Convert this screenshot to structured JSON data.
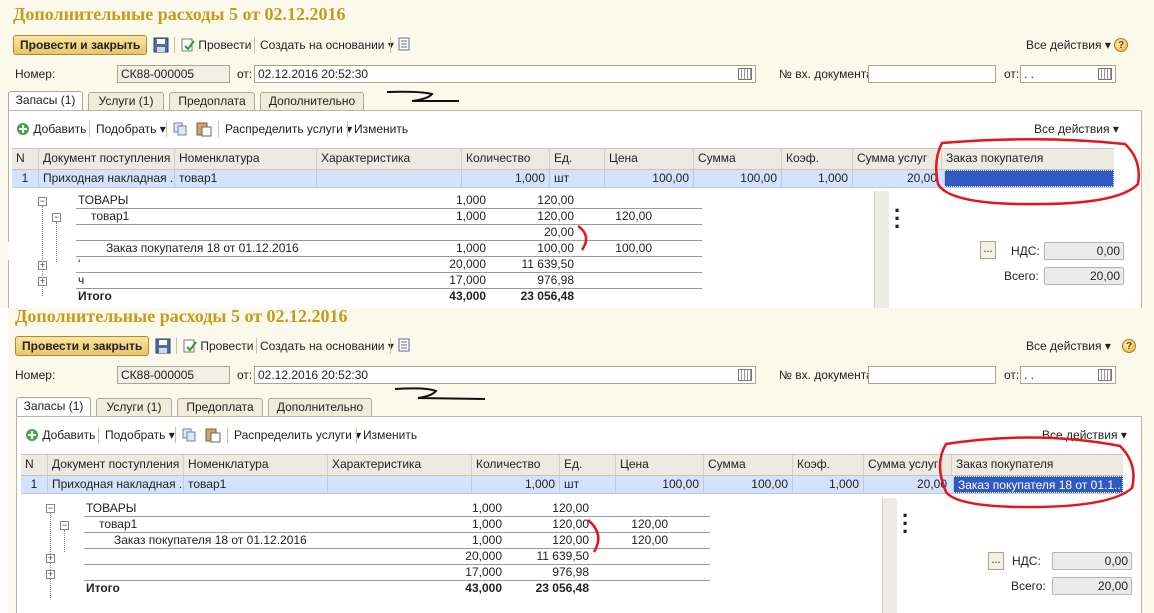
{
  "screens": [
    {
      "title": "Дополнительные расходы 5 от 02.12.2016",
      "toolbar": {
        "post_close": "Провести и закрыть",
        "post": "Провести",
        "create_based": "Создать на основании",
        "all_actions": "Все действия"
      },
      "form": {
        "number_label": "Номер:",
        "number": "СК88-000005",
        "date_label": "от:",
        "date": "02.12.2016 20:52:30",
        "in_doc_label": "№ вх. документа:",
        "in_doc": "",
        "in_date_label": "от:",
        "in_date": " .  ."
      },
      "tabs": [
        "Запасы (1)",
        "Услуги (1)",
        "Предоплата",
        "Дополнительно"
      ],
      "grid_toolbar": {
        "add": "Добавить",
        "select": "Подобрать",
        "distribute": "Распределить услуги",
        "change": "Изменить",
        "all_actions": "Все действия"
      },
      "columns": [
        "N",
        "Документ поступления",
        "Номенклатура",
        "Характеристика",
        "Количество",
        "Ед.",
        "Цена",
        "Сумма",
        "Коэф.",
        "Сумма услуг",
        "Заказ покупателя"
      ],
      "row": {
        "n": "1",
        "doc": "Приходная накладная ...",
        "item": "товар1",
        "char": "",
        "qty": "1,000",
        "unit": "шт",
        "price": "100,00",
        "sum": "100,00",
        "coef": "1,000",
        "service_sum": "20,00",
        "order": ""
      },
      "tree": [
        {
          "label": "ТОВАРЫ",
          "qty": "1,000",
          "sum": "120,00",
          "extra": ""
        },
        {
          "label": "товар1",
          "qty": "1,000",
          "sum": "120,00",
          "extra": "120,00"
        },
        {
          "label": "",
          "qty": "",
          "sum": "20,00",
          "extra": ""
        },
        {
          "label": "Заказ покупателя 18   от 01.12.2016",
          "qty": "1,000",
          "sum": "100,00",
          "extra": "100,00"
        },
        {
          "label": "'",
          "qty": "20,000",
          "sum": "11 639,50",
          "extra": ""
        },
        {
          "label": "ч",
          "qty": "17,000",
          "sum": "976,98",
          "extra": ""
        },
        {
          "label": "Итого",
          "qty": "43,000",
          "sum": "23 056,48",
          "extra": ""
        }
      ],
      "totals": {
        "vat_label": "НДС:",
        "vat": "0,00",
        "total_label": "Всего:",
        "total": "20,00"
      }
    },
    {
      "title": "Дополнительные расходы 5 от 02.12.2016",
      "toolbar": {
        "post_close": "Провести и закрыть",
        "post": "Провести",
        "create_based": "Создать на основании",
        "all_actions": "Все действия"
      },
      "form": {
        "number_label": "Номер:",
        "number": "СК88-000005",
        "date_label": "от:",
        "date": "02.12.2016 20:52:30",
        "in_doc_label": "№ вх. документа:",
        "in_doc": "",
        "in_date_label": "от:",
        "in_date": " .  ."
      },
      "tabs": [
        "Запасы (1)",
        "Услуги (1)",
        "Предоплата",
        "Дополнительно"
      ],
      "grid_toolbar": {
        "add": "Добавить",
        "select": "Подобрать",
        "distribute": "Распределить услуги",
        "change": "Изменить",
        "all_actions": "Все действия"
      },
      "columns": [
        "N",
        "Документ поступления",
        "Номенклатура",
        "Характеристика",
        "Количество",
        "Ед.",
        "Цена",
        "Сумма",
        "Коэф.",
        "Сумма услуг",
        "Заказ покупателя"
      ],
      "row": {
        "n": "1",
        "doc": "Приходная накладная ...",
        "item": "товар1",
        "char": "",
        "qty": "1,000",
        "unit": "шт",
        "price": "100,00",
        "sum": "100,00",
        "coef": "1,000",
        "service_sum": "20,00",
        "order": "Заказ покупателя 18   от 01.1..."
      },
      "tree": [
        {
          "label": "ТОВАРЫ",
          "qty": "1,000",
          "sum": "120,00",
          "extra": ""
        },
        {
          "label": "товар1",
          "qty": "1,000",
          "sum": "120,00",
          "extra": "120,00"
        },
        {
          "label": "Заказ покупателя 18   от 01.12.2016",
          "qty": "1,000",
          "sum": "120,00",
          "extra": "120,00"
        },
        {
          "label": "",
          "qty": "20,000",
          "sum": "11 639,50",
          "extra": ""
        },
        {
          "label": "",
          "qty": "17,000",
          "sum": "976,98",
          "extra": ""
        },
        {
          "label": "Итого",
          "qty": "43,000",
          "sum": "23 056,48",
          "extra": ""
        }
      ],
      "totals": {
        "vat_label": "НДС:",
        "vat": "0,00",
        "total_label": "Всего:",
        "total": "20,00"
      }
    }
  ]
}
